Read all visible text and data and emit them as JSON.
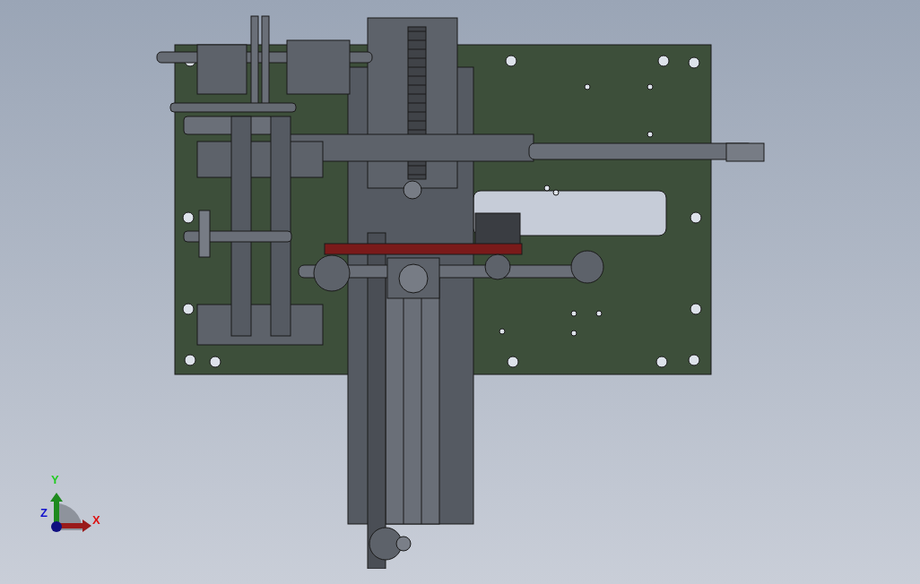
{
  "viewport": {
    "triad": {
      "axes": [
        {
          "kind": "y",
          "label": "Y",
          "color": "#22cc22"
        },
        {
          "kind": "x",
          "label": "X",
          "color": "#dd1111"
        },
        {
          "kind": "z",
          "label": "Z",
          "color": "#1111cc"
        }
      ]
    }
  }
}
